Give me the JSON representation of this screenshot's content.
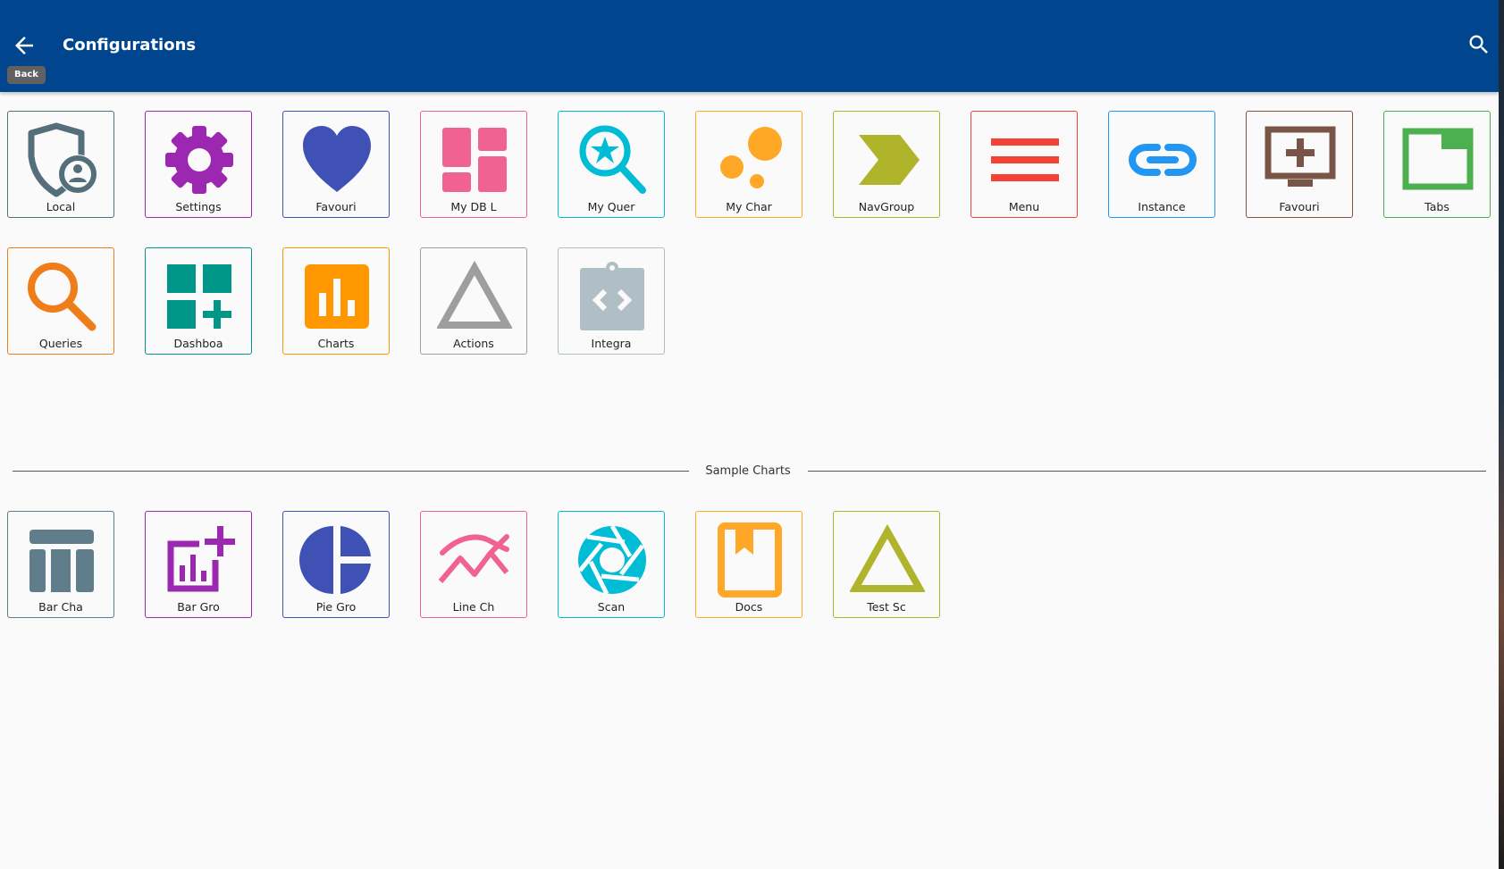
{
  "header": {
    "title": "Configurations",
    "back_tooltip": "Back",
    "bg_color": "#00458e"
  },
  "tiles": [
    {
      "label": "Local",
      "icon": "shield-user-icon",
      "color": "#546e7a"
    },
    {
      "label": "Settings",
      "icon": "gear-icon",
      "color": "#9c27b0"
    },
    {
      "label": "Favouri",
      "icon": "heart-icon",
      "color": "#3f51b5"
    },
    {
      "label": "My DB L",
      "icon": "dashboard-layout-icon",
      "color": "#f06292"
    },
    {
      "label": "My Quer",
      "icon": "search-star-icon",
      "color": "#00bcd4"
    },
    {
      "label": "My Char",
      "icon": "bubble-chart-icon",
      "color": "#ffa726"
    },
    {
      "label": "NavGroup",
      "icon": "chevron-shape-icon",
      "color": "#afb42b"
    },
    {
      "label": "Menu",
      "icon": "menu-icon",
      "color": "#f44336"
    },
    {
      "label": "Instance",
      "icon": "link-icon",
      "color": "#2196f3"
    },
    {
      "label": "Favouri",
      "icon": "add-to-queue-icon",
      "color": "#795548"
    },
    {
      "label": "Tabs",
      "icon": "tab-icon",
      "color": "#4caf50"
    },
    {
      "label": "Queries",
      "icon": "search-icon",
      "color": "#ef7d1a"
    },
    {
      "label": "Dashboa",
      "icon": "dashboard-add-icon",
      "color": "#009688"
    },
    {
      "label": "Charts",
      "icon": "bar-chart-icon",
      "color": "#ff9800"
    },
    {
      "label": "Actions",
      "icon": "triangle-icon",
      "color": "#9e9e9e"
    },
    {
      "label": "Integra",
      "icon": "code-clipboard-icon",
      "color": "#b0bec5"
    }
  ],
  "section": {
    "label": "Sample Charts"
  },
  "samples": [
    {
      "label": "Bar Cha",
      "icon": "table-chart-icon",
      "color": "#607d8b"
    },
    {
      "label": "Bar Gro",
      "icon": "add-chart-icon",
      "color": "#9c27b0"
    },
    {
      "label": "Pie Gro",
      "icon": "pie-chart-icon",
      "color": "#3f51b5"
    },
    {
      "label": "Line Ch",
      "icon": "line-chart-icon",
      "color": "#f06292"
    },
    {
      "label": "Scan",
      "icon": "camera-shutter-icon",
      "color": "#00bcd4"
    },
    {
      "label": "Docs",
      "icon": "book-bookmark-icon",
      "color": "#ffa726"
    },
    {
      "label": "Test Sc",
      "icon": "triangle-icon",
      "color": "#afb42b"
    }
  ]
}
